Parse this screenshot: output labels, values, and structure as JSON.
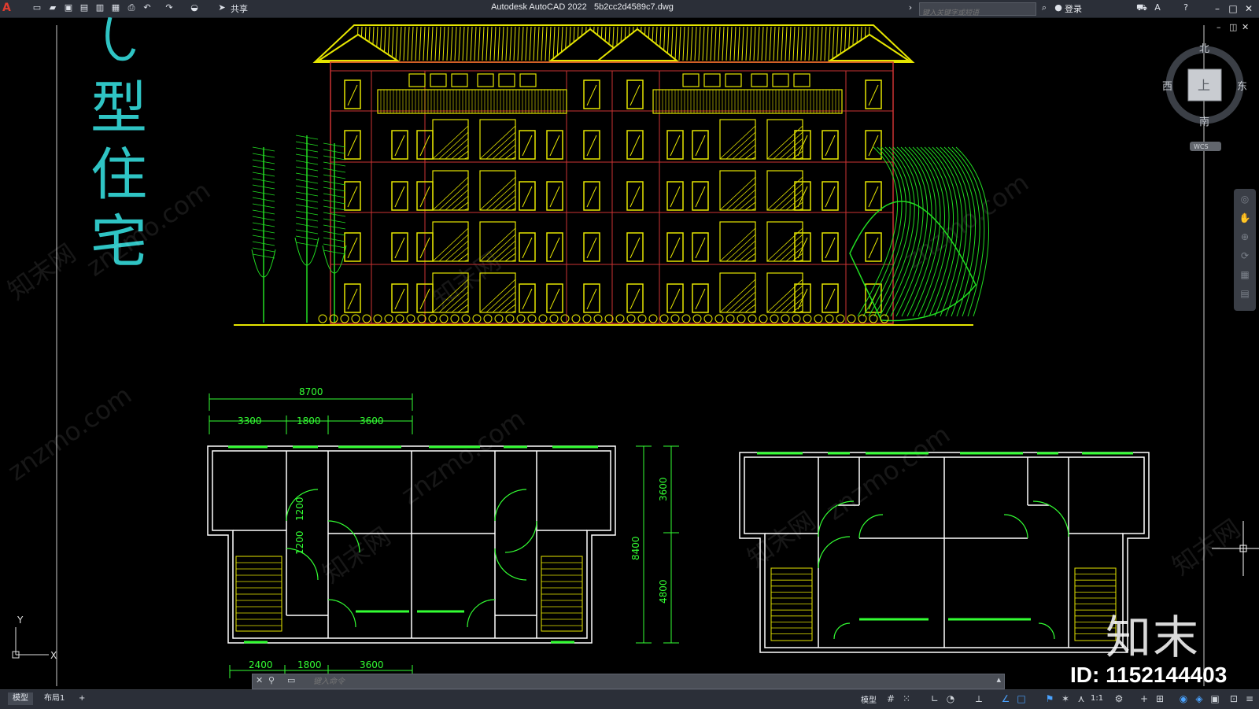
{
  "titlebar": {
    "app_name": "Autodesk AutoCAD 2022",
    "file_name": "5b2cc2d4589c7.dwg",
    "share": "共享",
    "search_placeholder": "键入关键字或短语",
    "login": "登录"
  },
  "drawing": {
    "title_text": [
      "型",
      "住",
      "宅"
    ],
    "dimensions_top": {
      "total": "8700",
      "parts": [
        "3300",
        "1800",
        "3600"
      ]
    },
    "dimensions_side": {
      "total": "8400",
      "parts": [
        "3600",
        "4800"
      ]
    },
    "dimensions_bottom": [
      "2400",
      "1800",
      "3600"
    ],
    "door_dims": [
      "1200",
      "1200"
    ],
    "ucs_x": "X",
    "ucs_y": "Y"
  },
  "viewcube": {
    "north": "北",
    "south": "南",
    "east": "东",
    "west": "西",
    "face": "上",
    "wcs": "WCS"
  },
  "commandline": {
    "placeholder": "键入命令"
  },
  "statusbar": {
    "tabs": [
      "模型",
      "布局1",
      "+"
    ],
    "model_label": "模型",
    "scale": "1:1"
  },
  "watermark": {
    "logo": "知末",
    "id": "ID: 1152144403",
    "site": "znzmo.com",
    "site_cn": "知末网"
  },
  "colors": {
    "background": "#000000",
    "building_yellow": "#e6e600",
    "plan_white": "#ffffff",
    "dims_green": "#33ff33",
    "trees_green": "#22dd22",
    "title_cyan": "#2fc4c4",
    "accent_red": "#cc3333"
  }
}
